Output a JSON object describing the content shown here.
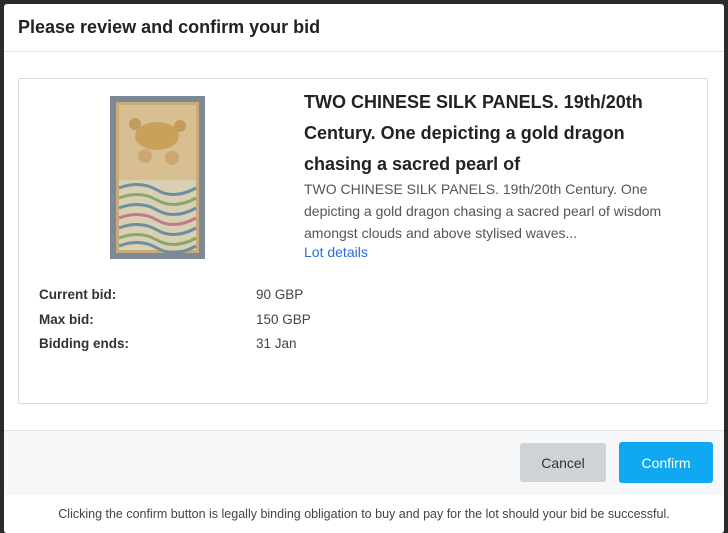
{
  "modal": {
    "title": "Please review and confirm your bid"
  },
  "lot": {
    "title": "TWO CHINESE SILK PANELS. 19th/20th Century. One depicting a gold dragon chasing a sacred pearl of",
    "description": "TWO CHINESE SILK PANELS. 19th/20th Century. One depicting a gold dragon chasing a sacred pearl of wisdom amongst clouds and above stylised waves...",
    "details_link": "Lot details",
    "image_icon": "silk-panel-thumbnail"
  },
  "details": {
    "current_bid_label": "Current bid:",
    "current_bid_value": "90 GBP",
    "max_bid_label": "Max bid:",
    "max_bid_value": "150 GBP",
    "bidding_ends_label": "Bidding ends:",
    "bidding_ends_value": "31 Jan"
  },
  "buttons": {
    "cancel": "Cancel",
    "confirm": "Confirm"
  },
  "notice": "Clicking the confirm button is legally binding obligation to buy and pay for the lot should your bid be successful.",
  "colors": {
    "accent": "#10a8f0",
    "cancel_bg": "#cfd3d6",
    "link": "#2a6fd6"
  }
}
